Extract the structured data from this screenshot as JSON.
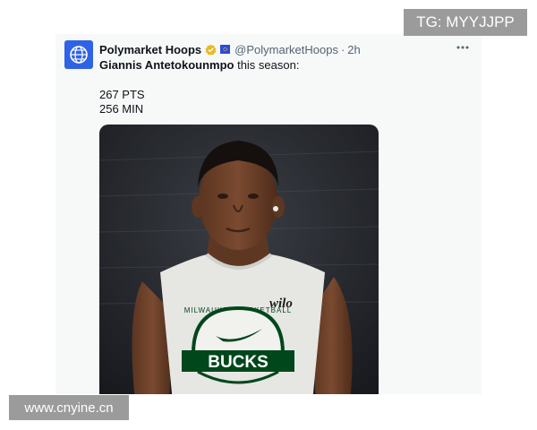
{
  "tweet": {
    "display_name": "Polymarket Hoops",
    "handle": "@PolymarketHoops",
    "separator": "·",
    "time": "2h",
    "subject_name": "Giannis Antetokounmpo",
    "subject_suffix": " this season:",
    "stats": [
      "267 PTS",
      "256 MIN"
    ],
    "more_icon": "ellipsis-icon",
    "verified_icon": "verified-badge-icon",
    "flag_icon": "eu-flag-icon"
  },
  "photo": {
    "jersey_brand": "wilo",
    "jersey_team": "BUCKS",
    "jersey_arc": "MILWAUKEE BASKETBALL"
  },
  "watermarks": {
    "top": "TG: MYYJJPP",
    "bottom": "www.cnyine.cn"
  },
  "colors": {
    "avatar": "#2f63e6",
    "bucks_green": "#00471b",
    "muted_text": "#536471"
  }
}
